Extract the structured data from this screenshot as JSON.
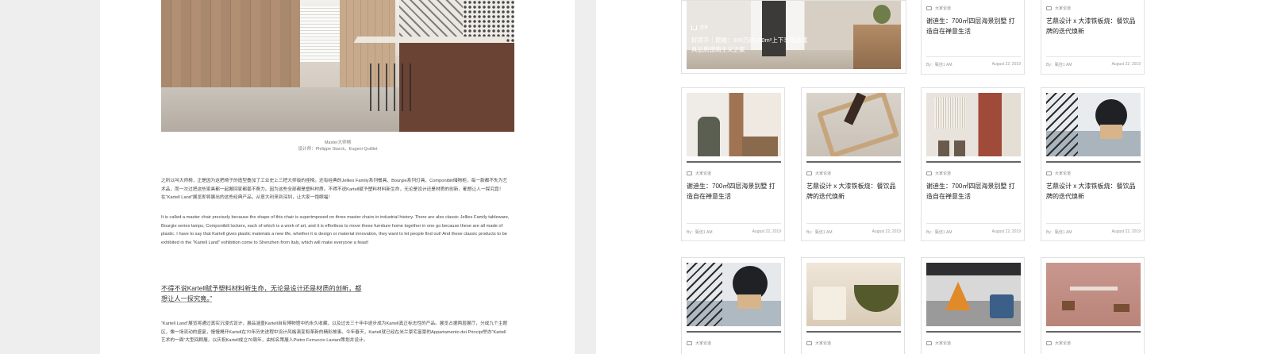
{
  "article": {
    "caption_line1": "Master大师椅",
    "caption_line2": "设计师：Philippe Starck、Eugeni Quitllet",
    "para_cn1": "之所以叫大师椅，正是因为这把椅子的造型叠加了工业史上三把大师级的座椅。还有经典的Jellies Family系列餐具、Bourgie系列灯具、Componibili储物柜，每一款都不失为艺术品，而一次过把这些家具都一起搬回家都毫不费力。因为这些全部都是塑料材质。不得不说Kartell赋予塑料材料新生命，无论是设计还是材质的创新，都想让人一探究竟！在“Kartell Land”展览即将展出的这些经典产品，从意大利来到深圳，让大家一饱眼福！",
    "para_en": "It is called a master chair precisely because the shape of this chair is superimposed on three master chairs in industrial history. There are also classic Jellies Family tableware, Bourgie series lamps, Componibili lockers, each of which is a work of art, and it is effortless to move these furniture home together in one go because these are all made of plastic. I have to say that Kartell gives plastic materials a new life, whether it is design or material innovation, they want to let people find out! And these classic products to be exhibited in the \"Kartell Land\" exhibition come to Shenzhen from Italy, which will make everyone a feast!",
    "quote": "不得不说Kartell赋予塑料材料新生命，无论是设计还是材质的创新，都想让人一探究竟。”",
    "para_cn2": "“Kartell Land”展览将通过真实沉浸式设计，展品涵盖Kartell自有博物馆中的永久收藏，以及过去三十年中逐步成为Kartell真正标志性的产品。展览占据两层展厅，分成九个主题区，像一场流动的盛宴，慢慢揭开Kartell在70年历史进程中设计风格演变和革新的精彩故事。今年春天，Kartell就已经在米兰豪宅富豪的Appartamento dei Principi举办“Kartell艺术的一面”大型回顾展，以庆祝Kartell成立70周年，由知名策展人Pietro Ferruccio Laviani策划并设计。"
  },
  "feature": {
    "category": "居家",
    "title": "好房子｜昆融：300万拼200m²上下享改造成具品质感简主义之家"
  },
  "cards": [
    {
      "category": "大家论道",
      "title": "谢迪生：700㎡四层海景别墅 打造自在禅意生活",
      "author": "By：甄佳1 AM",
      "date": "August 22, 2019"
    },
    {
      "category": "大家论道",
      "title": "艺鼎设计 x 大漆铁板烧：餐饮品牌的迭代焕新",
      "author": "By：甄佳1 AM",
      "date": "August 22, 2019"
    },
    {
      "category": "大家论道",
      "title": "谢迪生：700㎡四层海景别墅 打造自在禅意生活",
      "author": "By：甄佳1 AM",
      "date": "August 22, 2019"
    },
    {
      "category": "大家论道",
      "title": "艺鼎设计 x 大漆铁板烧：餐饮品牌的迭代焕新",
      "author": "By：甄佳1 AM",
      "date": "August 22, 2019"
    },
    {
      "category": "大家论道",
      "title": "谢迪生：700㎡四层海景别墅 打造自在禅意生活",
      "author": "By：甄佳1 AM",
      "date": "August 22, 2019"
    },
    {
      "category": "大家论道",
      "title": "艺鼎设计 x 大漆铁板烧：餐饮品牌的迭代焕新",
      "author": "By：甄佳1 AM",
      "date": "August 22, 2019"
    },
    {
      "category": "大家论道"
    },
    {
      "category": "大家论道"
    },
    {
      "category": "大家论道"
    },
    {
      "category": "大家论道"
    }
  ]
}
